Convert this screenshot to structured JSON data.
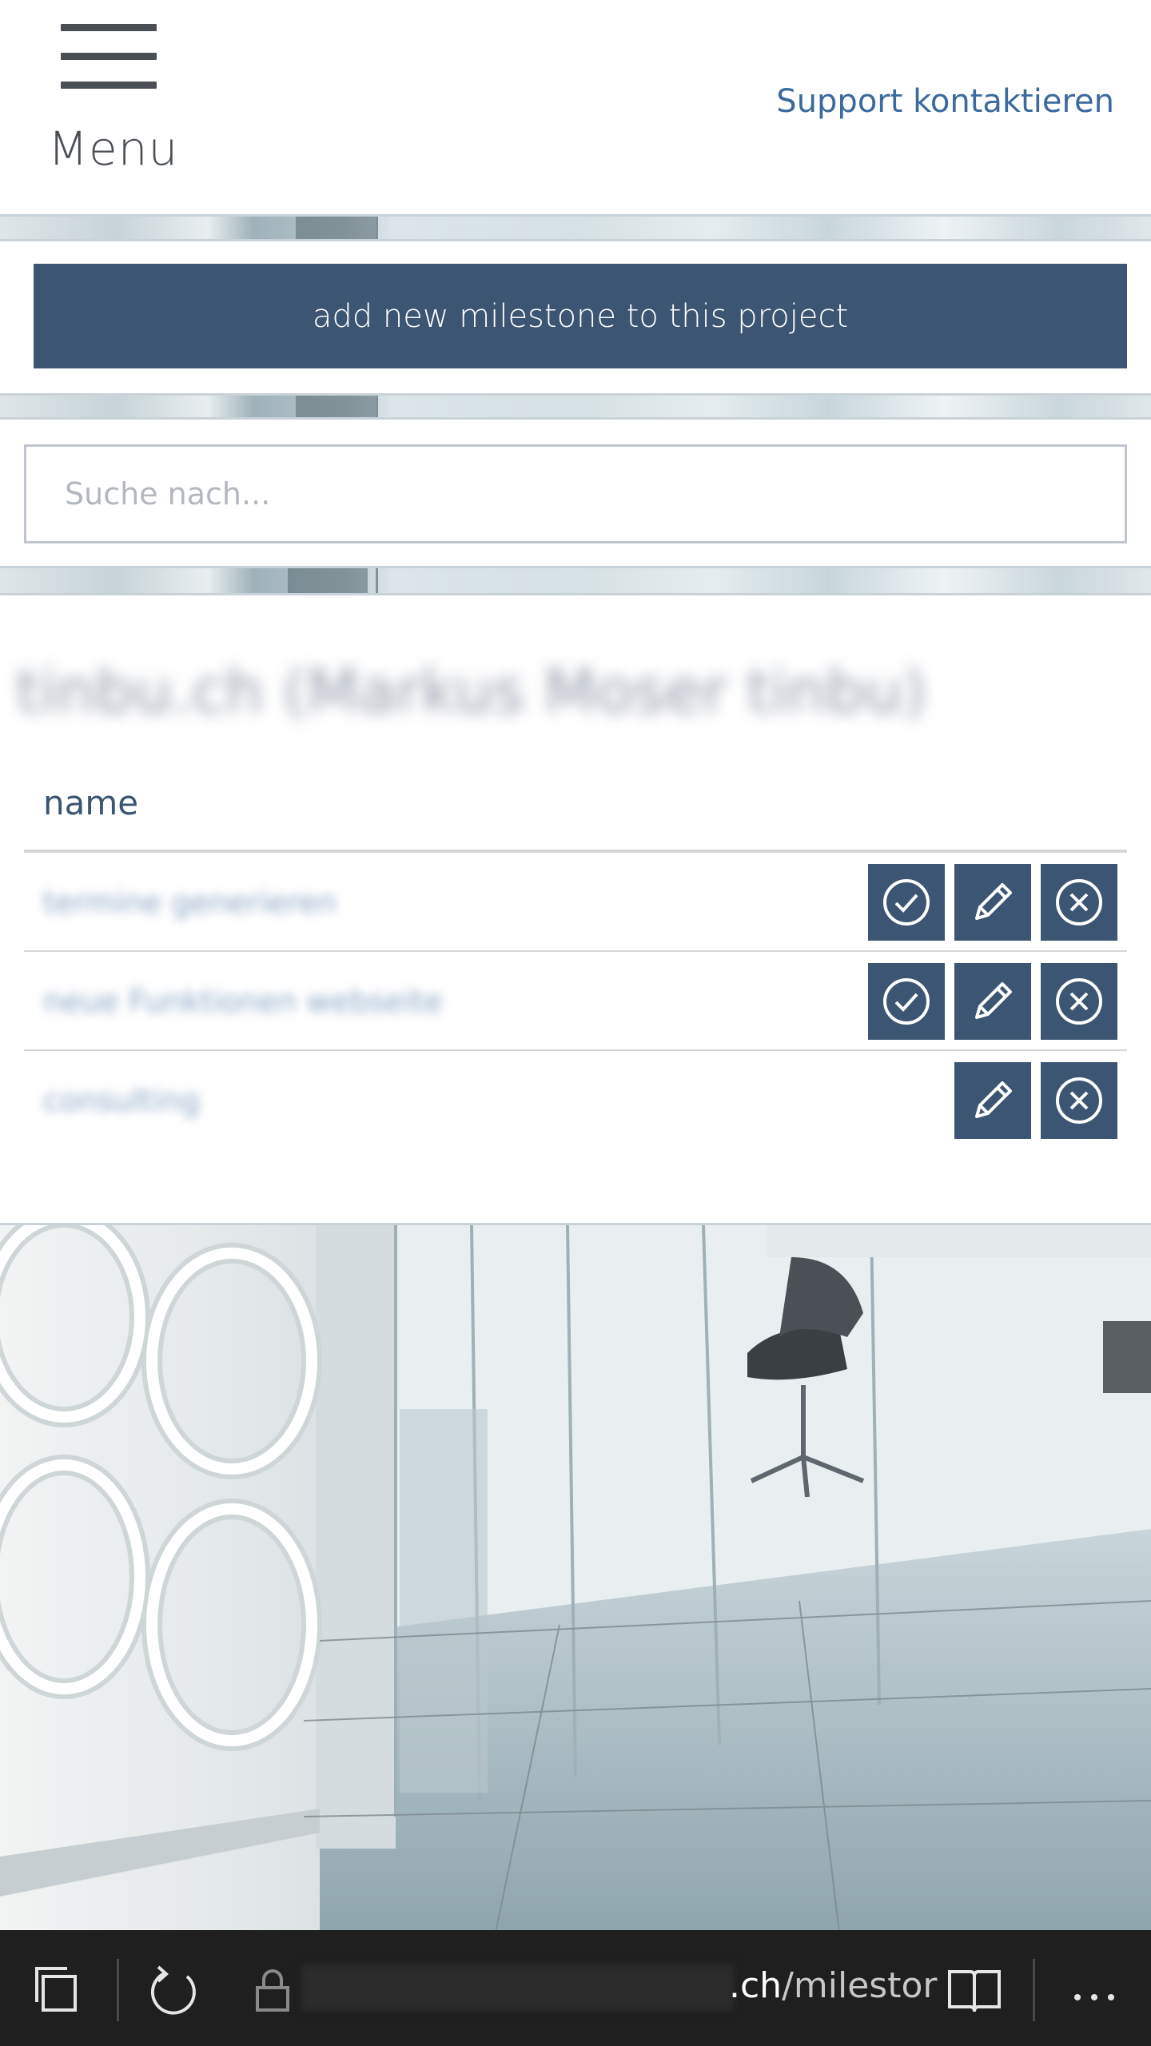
{
  "header": {
    "menu_label": "Menu",
    "support_link": "Support kontaktieren"
  },
  "actions": {
    "add_milestone_label": "add new milestone to this project"
  },
  "search": {
    "placeholder": "Suche nach..."
  },
  "project": {
    "title": "tinbu.ch (Markus Moser tinbu)"
  },
  "table": {
    "column_header": "name",
    "rows": [
      {
        "name": "termine generieren",
        "buttons": [
          "complete",
          "edit",
          "delete"
        ]
      },
      {
        "name": "neue Funktionen webseite",
        "buttons": [
          "complete",
          "edit",
          "delete"
        ]
      },
      {
        "name": "consulting",
        "buttons": [
          "edit",
          "delete"
        ]
      }
    ]
  },
  "browser": {
    "url_domain_suffix": ".ch",
    "url_path": "/milestor"
  },
  "icons": [
    "hamburger-icon",
    "check-circle-icon",
    "pencil-icon",
    "x-circle-icon",
    "tabs-icon",
    "refresh-icon",
    "lock-icon",
    "reading-view-icon",
    "more-icon"
  ],
  "colors": {
    "accent": "#3b5572",
    "link": "#3b6a9e",
    "browser_bar": "#1f1f1f"
  }
}
